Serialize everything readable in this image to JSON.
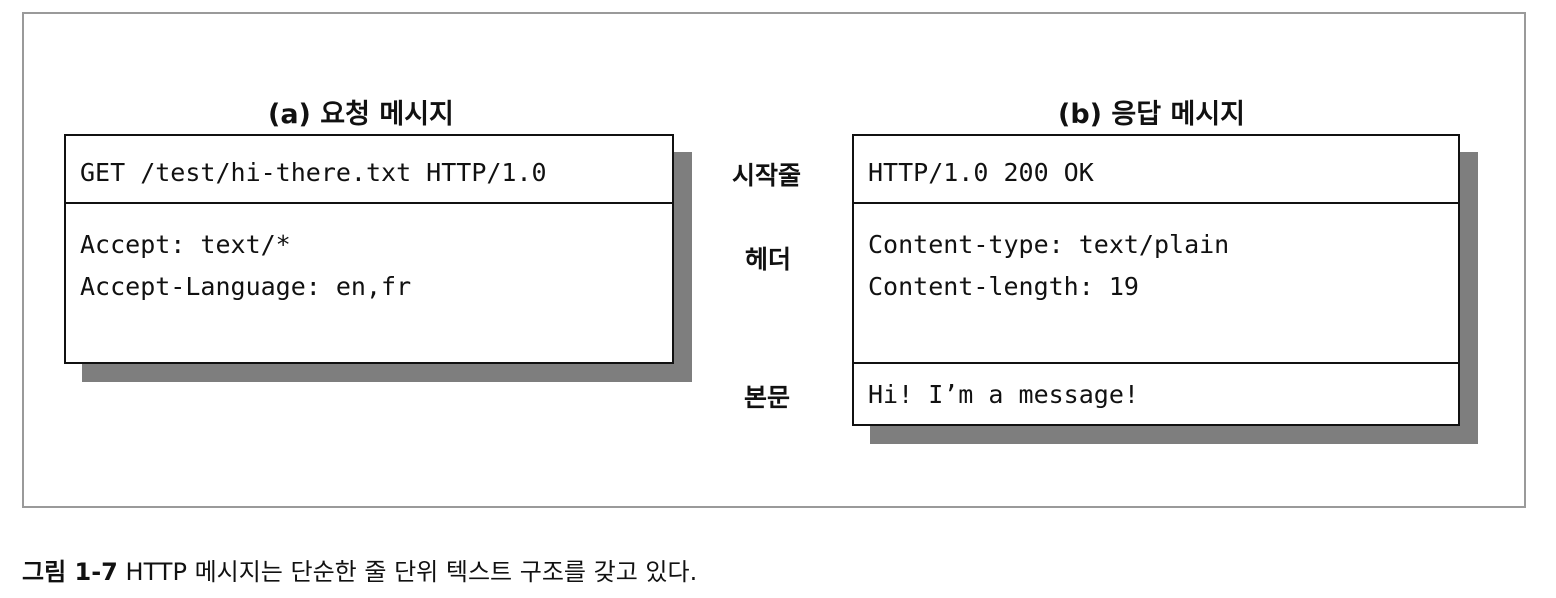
{
  "request": {
    "title": "(a) 요청 메시지",
    "start_line": "GET /test/hi-there.txt HTTP/1.0",
    "headers": [
      "Accept: text/*",
      "Accept-Language: en,fr"
    ]
  },
  "response": {
    "title": "(b) 응답 메시지",
    "start_line": "HTTP/1.0 200 OK",
    "headers": [
      "Content-type: text/plain",
      "Content-length: 19"
    ],
    "body": "Hi! I’m a message!"
  },
  "labels": {
    "start_line": "시작줄",
    "headers": "헤더",
    "body": "본문"
  },
  "caption": {
    "number": "그림 1-7",
    "text": "HTTP 메시지는 단순한 줄 단위 텍스트 구조를 갖고 있다."
  },
  "colors": {
    "border": "#111111",
    "shadow": "#7e7e7e",
    "frame": "#9a9a9a"
  }
}
